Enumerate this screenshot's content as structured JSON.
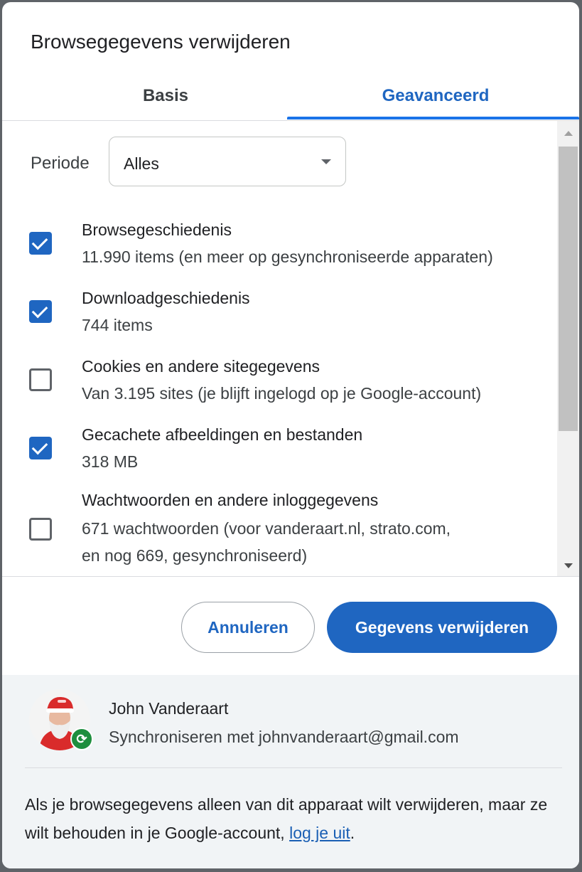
{
  "dialog": {
    "title": "Browsegegevens verwijderen"
  },
  "tabs": [
    {
      "label": "Basis",
      "selected": false
    },
    {
      "label": "Geavanceerd",
      "selected": true
    }
  ],
  "period": {
    "label": "Periode",
    "value": "Alles"
  },
  "options": [
    {
      "title": "Browsegeschiedenis",
      "lines": [
        "11.990 items (en meer op gesynchroniseerde apparaten)"
      ],
      "checked": true
    },
    {
      "title": "Downloadgeschiedenis",
      "lines": [
        "744 items"
      ],
      "checked": true
    },
    {
      "title": "Cookies en andere sitegegevens",
      "lines": [
        "Van 3.195 sites (je blijft ingelogd op je Google-account)"
      ],
      "checked": false
    },
    {
      "title": "Gecachete afbeeldingen en bestanden",
      "lines": [
        "318 MB"
      ],
      "checked": true
    },
    {
      "title": "Wachtwoorden en andere inloggegevens",
      "lines": [
        "671 wachtwoorden (voor vanderaart.nl, strato.com,",
        "en nog 669, gesynchroniseerd)"
      ],
      "checked": false
    }
  ],
  "buttons": {
    "cancel": "Annuleren",
    "delete": "Gegevens verwijderen"
  },
  "account": {
    "name": "John Vanderaart",
    "sync": "Synchroniseren met johnvanderaart@gmail.com"
  },
  "info": {
    "text_before": "Als je browsegegevens alleen van dit apparaat wilt verwijderen, maar ze wilt behouden in je Google-account,",
    "link": "log je uit",
    "text_after": "."
  },
  "colors": {
    "accent": "#1f66c1",
    "tab_underline": "#1a73e8",
    "footer_bg": "#f1f4f6",
    "sync_badge": "#1e8e3e"
  }
}
